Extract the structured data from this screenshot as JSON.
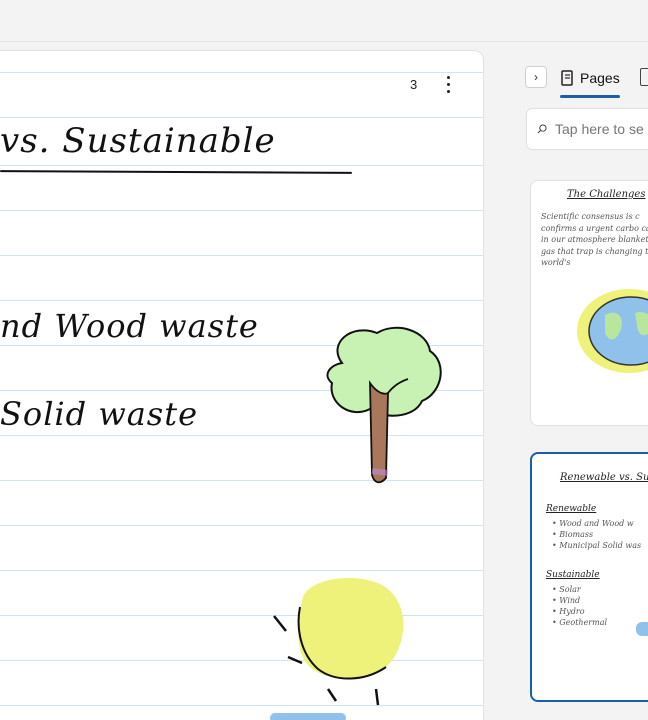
{
  "canvas": {
    "page_count": "3",
    "title_text": "vs. Sustainable",
    "line1_text": "nd Wood waste",
    "line2_text": "Solid waste"
  },
  "sidebar": {
    "pages_tab_label": "Pages",
    "search_placeholder": "Tap here to se",
    "thumbnails": [
      {
        "title": "The Challenges",
        "body": "Scientific consensus is c confirms a urgent carbo carbon in our atmosphere blanket of gas that trap is changing the world's"
      },
      {
        "title": "Renewable vs. Sustai",
        "renewable_heading": "Renewable",
        "renewable_items": [
          "Wood and Wood w",
          "Biomass",
          "Municipal Solid was"
        ],
        "sustainable_heading": "Sustainable",
        "sustainable_items": [
          "Solar",
          "Wind",
          "Hydro",
          "Geothermal"
        ]
      }
    ]
  },
  "colors": {
    "accent": "#1a5fa6",
    "ruling": "#cfe3f2",
    "tree_leaves": "#c8f2b4",
    "tree_trunk": "#a9775a",
    "sun": "#eef27a",
    "earth_ring": "#eef27a",
    "earth_water": "#8fc1ea"
  }
}
